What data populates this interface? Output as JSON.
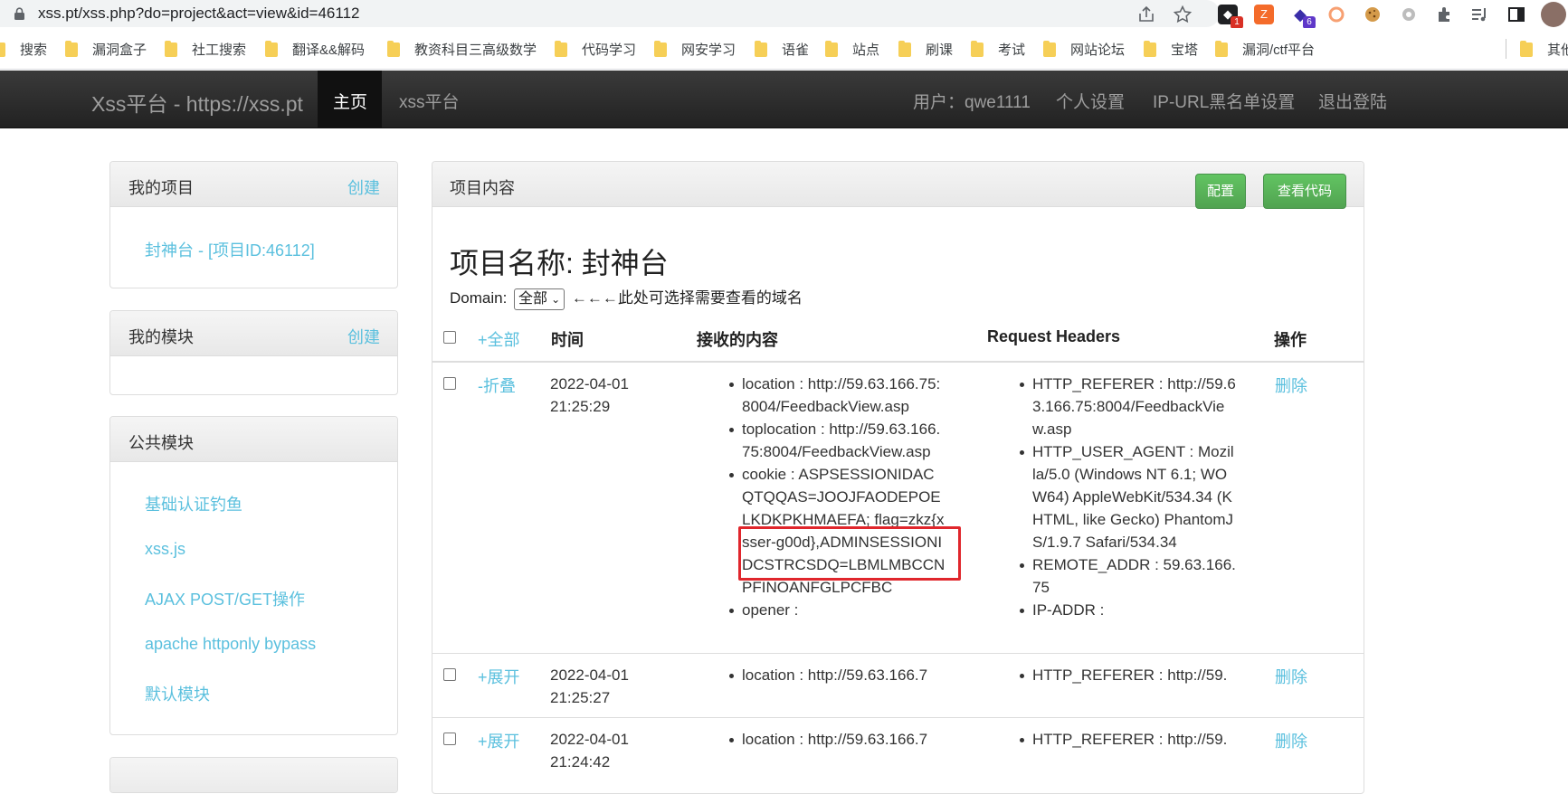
{
  "browser": {
    "url": "xss.pt/xss.php?do=project&act=view&id=46112",
    "extensions": [
      {
        "icon": "bug-extension-icon",
        "badge": "1",
        "badge_color": "#d93025"
      },
      {
        "icon": "z-extension-icon",
        "badge": "",
        "badge_color": ""
      },
      {
        "icon": "shield-extension-icon",
        "badge": "6",
        "badge_color": "#5f38c9"
      }
    ],
    "bookmarks": [
      "搜索",
      "漏洞盒子",
      "社工搜索",
      "翻译&&解码",
      "教资科目三高级数学",
      "代码学习",
      "网安学习",
      "语雀",
      "站点",
      "刷课",
      "考试",
      "网站论坛",
      "宝塔",
      "漏洞/ctf平台",
      "其他"
    ]
  },
  "navbar": {
    "brand": "Xss平台 - https://xss.pt",
    "home": "主页",
    "xss": "xss平台",
    "user": "用户：qwe1111",
    "settings": "个人设置",
    "blacklist": "IP-URL黑名单设置",
    "logout": "退出登陆"
  },
  "sidebar": {
    "projects": {
      "title": "我的项目",
      "create": "创建",
      "items": [
        "封神台 - [项目ID:46112]"
      ]
    },
    "modules": {
      "title": "我的模块",
      "create": "创建"
    },
    "public": {
      "title": "公共模块",
      "items": [
        "基础认证钓鱼",
        "xss.js",
        "AJAX POST/GET操作",
        "apache httponly bypass",
        "默认模块"
      ]
    }
  },
  "main": {
    "panel_title": "项目内容",
    "btn_config": "配置",
    "btn_code": "查看代码",
    "project_title": "项目名称: 封神台",
    "domain_label": "Domain:",
    "domain_value": "全部",
    "domain_hint": "←←←此处可选择需要查看的域名",
    "headers": {
      "expand_all": "+全部",
      "time": "时间",
      "content": "接收的内容",
      "request": "Request Headers",
      "action": "操作"
    },
    "rows": [
      {
        "toggle": "-折叠",
        "date": "2022-04-01",
        "time": "21:25:29",
        "content": [
          "location : http://59.63.166.75:8004/FeedbackView.asp",
          "toplocation : http://59.63.166.75:8004/FeedbackView.asp",
          "cookie : ASPSESSIONIDACQTQQAS=JOOJFAODEPOELKDKPKHMAEFA; flag=zkz{xsser-g00d},ADMINSESSIONIDCSTRCSDQ=LBMLMBCCNPFINOANFGLPCFBC",
          "opener :"
        ],
        "headers": [
          "HTTP_REFERER : http://59.63.166.75:8004/FeedbackView.asp",
          "HTTP_USER_AGENT : Mozilla/5.0 (Windows NT 6.1; WOW64) AppleWebKit/534.34 (KHTML, like Gecko) PhantomJS/1.9.7 Safari/534.34",
          "REMOTE_ADDR : 59.63.166.75",
          "IP-ADDR :"
        ],
        "delete": "删除"
      },
      {
        "toggle": "+展开",
        "date": "2022-04-01",
        "time": "21:25:27",
        "content": [
          "location : http://59.63.166.7"
        ],
        "headers": [
          "HTTP_REFERER : http://59."
        ],
        "delete": "删除"
      },
      {
        "toggle": "+展开",
        "date": "2022-04-01",
        "time": "21:24:42",
        "content": [
          "location : http://59.63.166.7"
        ],
        "headers": [
          "HTTP_REFERER : http://59."
        ],
        "delete": "删除"
      }
    ]
  }
}
